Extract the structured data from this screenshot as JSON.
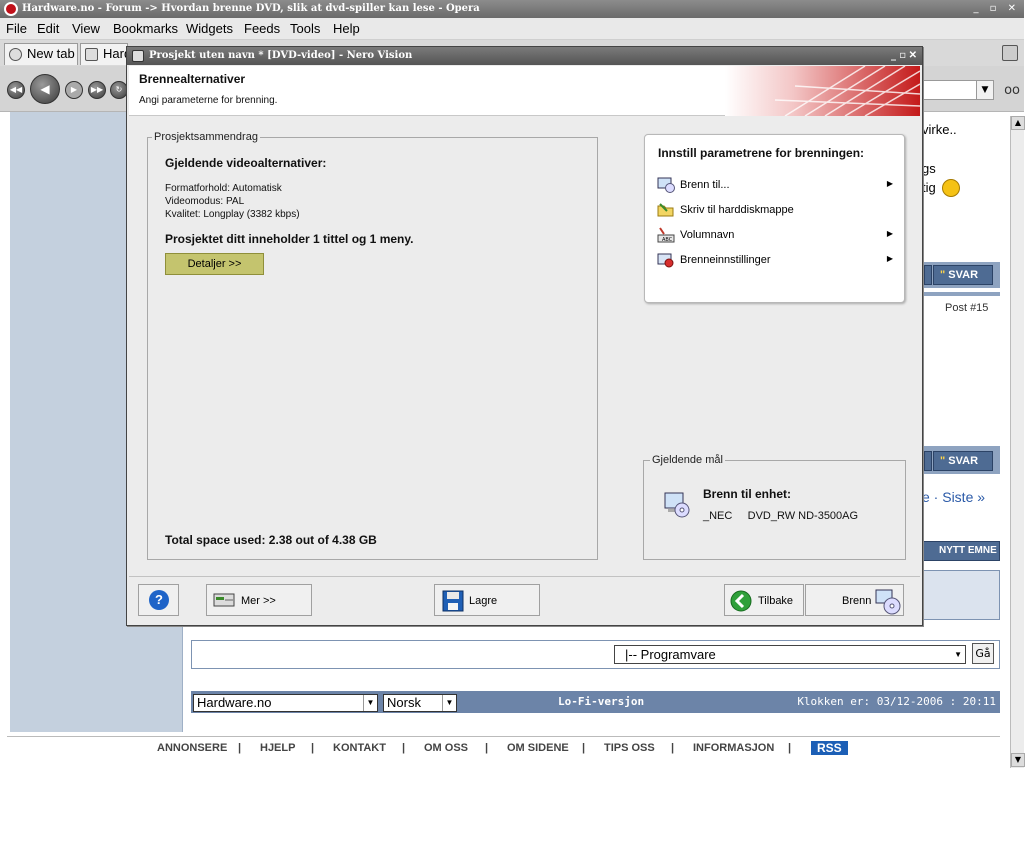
{
  "opera": {
    "title": "Hardware.no - Forum -> Hvordan brenne DVD, slik at dvd-spiller kan lese - Opera",
    "menu": [
      "File",
      "Edit",
      "View",
      "Bookmarks",
      "Widgets",
      "Feeds",
      "Tools",
      "Help"
    ],
    "tabs": [
      "New tab",
      "Hard"
    ]
  },
  "forum": {
    "snippet_1": "virke..",
    "snippet_2": "gs",
    "snippet_3": "tig",
    "svar_label": "SVAR",
    "post_label": "Post #15",
    "pager_text": "e · Siste »",
    "nytt_emne": "NYTT EMNE",
    "jump_select": "|-- Programvare",
    "jump_go": "Gå",
    "site_select": "Hardware.no",
    "lang_select": "Norsk",
    "lofi": "Lo-Fi-versjon",
    "clock": "Klokken er: 03/12-2006 : 20:11",
    "bottom_links": [
      "ANNONSERE",
      "HJELP",
      "KONTAKT",
      "OM OSS",
      "OM SIDENE",
      "TIPS OSS",
      "INFORMASJON"
    ],
    "separator": "|",
    "rss": "RSS"
  },
  "nero": {
    "window_title": "Prosjekt uten navn * [DVD-video] - Nero Vision",
    "header_title": "Brennealternativer",
    "header_subtitle": "Angi parameterne for brenning.",
    "summary_legend": "Prosjektsammendrag",
    "video_options_heading": "Gjeldende videoalternativer:",
    "format": "Formatforhold: Automatisk",
    "video_mode": "Videomodus: PAL",
    "quality": "Kvalitet: Longplay (3382 kbps)",
    "project_contains": "Prosjektet ditt inneholder 1 tittel og 1 meny.",
    "details_button": "Detaljer >>",
    "total_space": "Total space used: 2.38 out of 4.38 GB",
    "params_heading": "Innstill parametrene for brenningen:",
    "params_items": [
      {
        "label": "Brenn til...",
        "icon": "burn-drive-icon",
        "has_submenu": true
      },
      {
        "label": "Skriv til harddiskmappe",
        "icon": "folder-icon",
        "has_submenu": false
      },
      {
        "label": "Volumnavn",
        "icon": "volume-name-icon",
        "has_submenu": true
      },
      {
        "label": "Brenneinnstillinger",
        "icon": "burn-settings-icon",
        "has_submenu": true
      }
    ],
    "target_legend": "Gjeldende mål",
    "target_heading": "Brenn til enhet:",
    "target_device": "_NEC     DVD_RW ND-3500AG",
    "buttons": {
      "help": "?",
      "more": "Mer >>",
      "save": "Lagre",
      "back": "Tilbake",
      "burn": "Brenn"
    }
  },
  "colors": {
    "nero_bg": "#ececec",
    "details_button": "#c4c46e",
    "forum_blue": "#4e6b93",
    "rss": "#1c5fb6"
  }
}
